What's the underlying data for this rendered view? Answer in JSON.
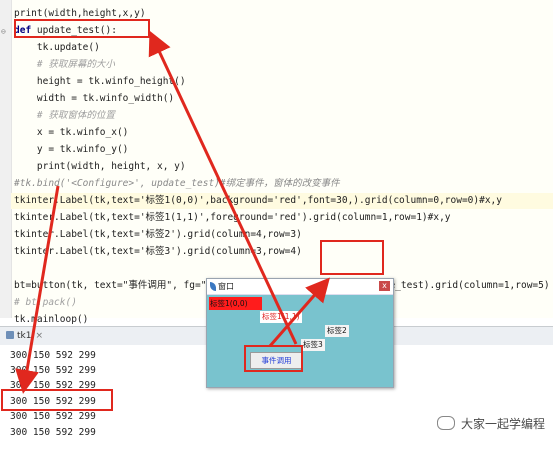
{
  "editor": {
    "code_lines": [
      {
        "id": "l0",
        "text": "print(width,height,x,y)"
      },
      {
        "id": "l1",
        "kw": "def",
        "text": " update_test():"
      },
      {
        "id": "l2",
        "text": "    tk.update()"
      },
      {
        "id": "l3",
        "comment": "    # 获取屏幕的大小"
      },
      {
        "id": "l4",
        "text": "    height = tk.winfo_height()"
      },
      {
        "id": "l5",
        "text": "    width = tk.winfo_width()"
      },
      {
        "id": "l6",
        "comment": "    # 获取窗体的位置"
      },
      {
        "id": "l7",
        "text": "    x = tk.winfo_x()"
      },
      {
        "id": "l8",
        "text": "    y = tk.winfo_y()"
      },
      {
        "id": "l9",
        "text": "    print(width, height, x, y)"
      },
      {
        "id": "l10",
        "comment": "#tk.bind('<Configure>', update_test)#绑定事件，窗体的改变事件"
      },
      {
        "id": "l11",
        "text": "tkinter.Label(tk,text='标签1(0,0)',background='red',font=30,).grid(column=0,row=0)#x,y"
      },
      {
        "id": "l12",
        "text": "tkinter.Label(tk,text='标签1(1,1)',foreground='red').grid(column=1,row=1)#x,y"
      },
      {
        "id": "l13",
        "text": "tkinter.Label(tk,text='标签2').grid(column=4,row=3)"
      },
      {
        "id": "l14",
        "text": "tkinter.Label(tk,text='标签3').grid(column=3,row=4)"
      },
      {
        "id": "l15",
        "text": ""
      },
      {
        "id": "l16",
        "text": "bt=button(tk, text=\"事件调用\", fg=\"blue\",bd=2,width=8,command=update_test).grid(column=1,row=5)"
      },
      {
        "id": "l17",
        "comment": "# bt.pack()"
      },
      {
        "id": "l18",
        "text": "tk.mainloop()"
      }
    ]
  },
  "run_panel": {
    "tab_label": "tk1",
    "close_glyph": "×",
    "output_lines": [
      "300 150 592 299",
      "300 150 592 299",
      "300 150 592 299",
      "300 150 592 299",
      "300 150 592 299",
      "300 150 592 299"
    ]
  },
  "tk_window": {
    "title": "窗口",
    "close_glyph": "x",
    "label_red_bg": "标签1(0,0)",
    "label_red_fg": "标签1(1,1)",
    "label_2": "标签2",
    "label_3": "标签3",
    "button": "事件调用"
  },
  "watermark": "大家一起学编程",
  "colors": {
    "annotation": "#e0281e",
    "window_bg": "#79c3ce",
    "label_red": "#ff1c1c",
    "button_text": "#1e3ad8"
  }
}
